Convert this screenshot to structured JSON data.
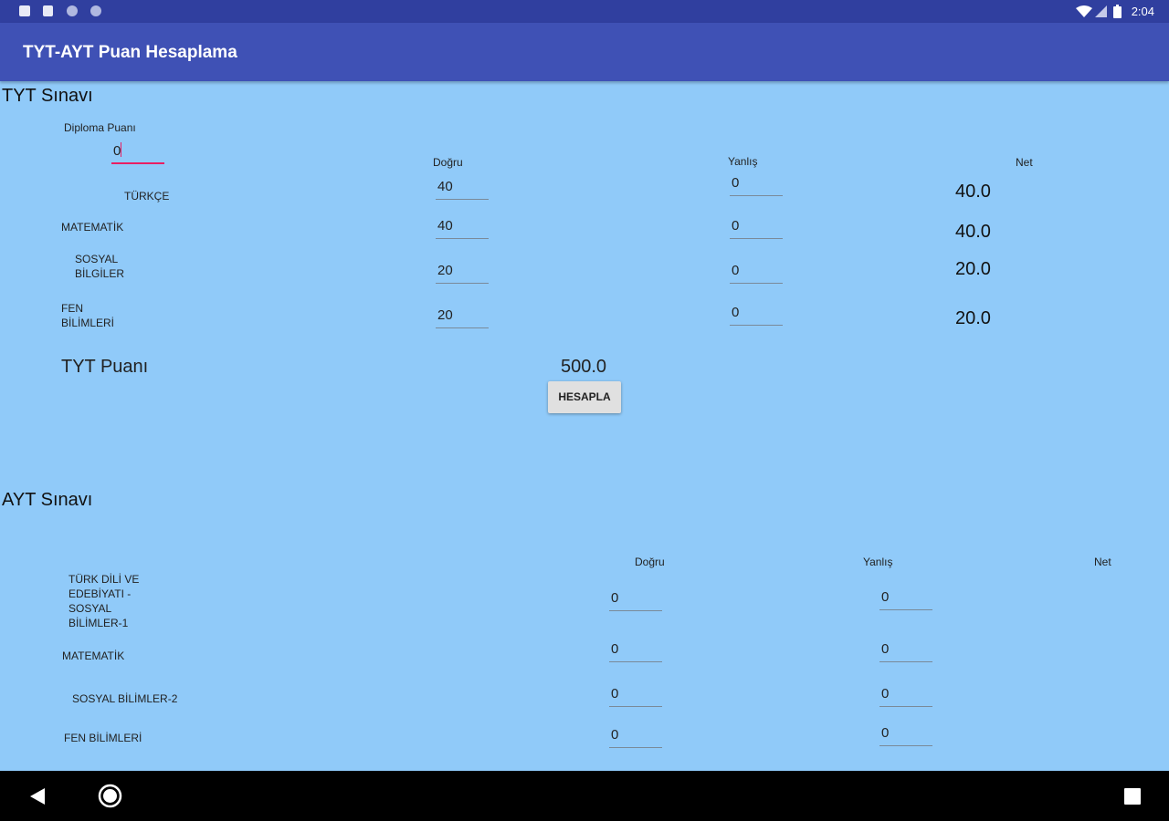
{
  "status": {
    "time": "2:04"
  },
  "app": {
    "title": "TYT-AYT Puan Hesaplama"
  },
  "tyt": {
    "title": "TYT Sınavı",
    "diploma_label": "Diploma Puanı",
    "diploma_value": "0",
    "headers": {
      "dogru": "Doğru",
      "yanlis": "Yanlış",
      "net": "Net"
    },
    "rows": [
      {
        "label": "TÜRKÇE",
        "dogru": "40",
        "yanlis": "0",
        "net": "40.0"
      },
      {
        "label": "MATEMATİK",
        "dogru": "40",
        "yanlis": "0",
        "net": "40.0"
      },
      {
        "label": "SOSYAL BİLGİLER",
        "dogru": "20",
        "yanlis": "0",
        "net": "20.0"
      },
      {
        "label": "FEN BİLİMLERİ",
        "dogru": "20",
        "yanlis": "0",
        "net": "20.0"
      }
    ],
    "score_label": "TYT Puanı",
    "score_value": "500.0",
    "button_label": "HESAPLA"
  },
  "ayt": {
    "title": "AYT Sınavı",
    "headers": {
      "dogru": "Doğru",
      "yanlis": "Yanlış",
      "net": "Net"
    },
    "rows": [
      {
        "label": "TÜRK DİLİ VE EDEBİYATI - SOSYAL BİLİMLER-1",
        "dogru": "0",
        "yanlis": "0"
      },
      {
        "label": "MATEMATİK",
        "dogru": "0",
        "yanlis": "0"
      },
      {
        "label": "SOSYAL BİLİMLER-2",
        "dogru": "0",
        "yanlis": "0"
      },
      {
        "label": "FEN BİLİMLERİ",
        "dogru": "0",
        "yanlis": "0"
      }
    ]
  },
  "icons": [
    "notification-icon",
    "sd-card-icon",
    "sync-icon",
    "wifi-icon",
    "signal-icon",
    "battery-icon",
    "back-icon",
    "home-icon",
    "recents-icon"
  ]
}
